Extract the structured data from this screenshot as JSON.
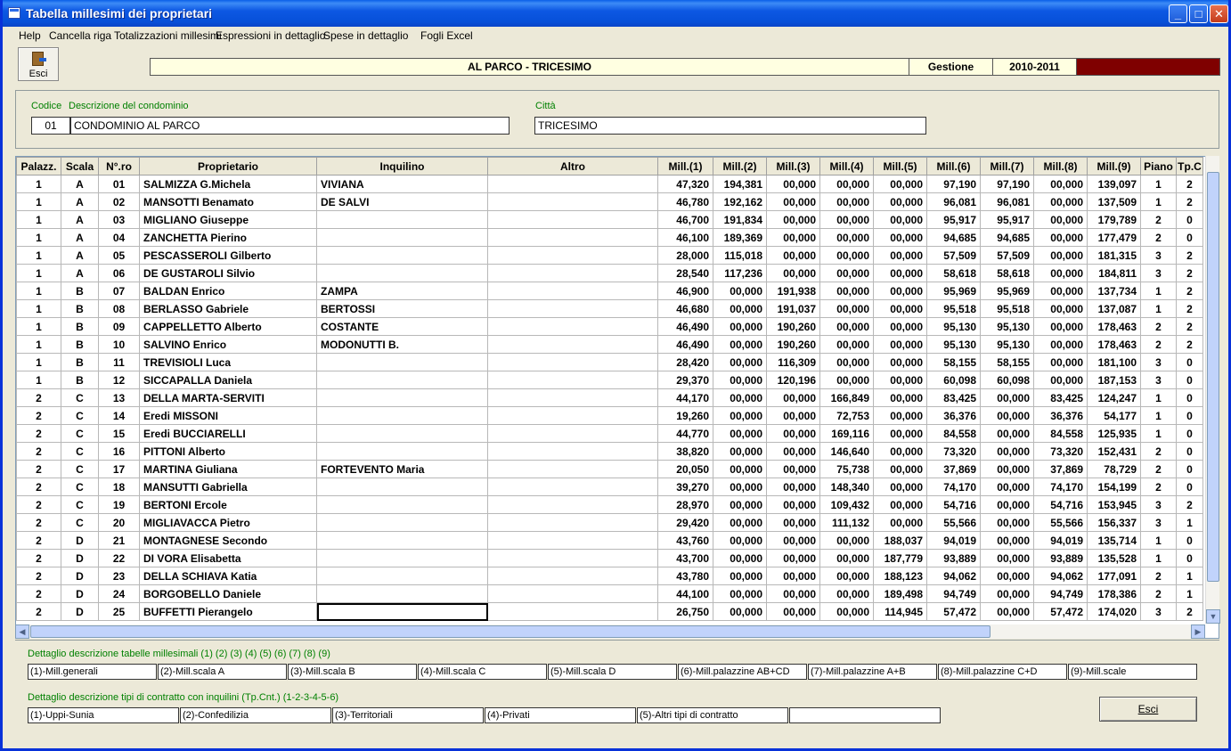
{
  "window": {
    "title": "Tabella millesimi dei proprietari"
  },
  "menu": [
    "Help",
    "Cancella riga",
    "Totalizzazioni millesimi",
    "Espressioni in dettaglio",
    "Spese in dettaglio",
    "Fogli Excel"
  ],
  "toolbar": {
    "esci_label": "Esci"
  },
  "header": {
    "condo_name": "AL PARCO - TRICESIMO",
    "gestione_label": "Gestione",
    "year": "2010-2011",
    "status_color": "#7F0000"
  },
  "condo": {
    "codice_label": "Codice",
    "descr_label": "Descrizione del condominio",
    "citta_label": "Città",
    "codice": "01",
    "descrizione": "CONDOMINIO AL PARCO",
    "citta": "TRICESIMO"
  },
  "grid": {
    "columns": [
      "Palazz.",
      "Scala",
      "N°.ro",
      "Proprietario",
      "Inquilino",
      "Altro",
      "Mill.(1)",
      "Mill.(2)",
      "Mill.(3)",
      "Mill.(4)",
      "Mill.(5)",
      "Mill.(6)",
      "Mill.(7)",
      "Mill.(8)",
      "Mill.(9)",
      "Piano",
      "Tp.C"
    ],
    "rows": [
      [
        "1",
        "A",
        "01",
        "SALMIZZA G.Michela",
        "VIVIANA",
        "",
        "47,320",
        "194,381",
        "00,000",
        "00,000",
        "00,000",
        "97,190",
        "97,190",
        "00,000",
        "139,097",
        "1",
        "2"
      ],
      [
        "1",
        "A",
        "02",
        "MANSOTTI Benamato",
        "DE SALVI",
        "",
        "46,780",
        "192,162",
        "00,000",
        "00,000",
        "00,000",
        "96,081",
        "96,081",
        "00,000",
        "137,509",
        "1",
        "2"
      ],
      [
        "1",
        "A",
        "03",
        "MIGLIANO Giuseppe",
        "",
        "",
        "46,700",
        "191,834",
        "00,000",
        "00,000",
        "00,000",
        "95,917",
        "95,917",
        "00,000",
        "179,789",
        "2",
        "0"
      ],
      [
        "1",
        "A",
        "04",
        "ZANCHETTA Pierino",
        "",
        "",
        "46,100",
        "189,369",
        "00,000",
        "00,000",
        "00,000",
        "94,685",
        "94,685",
        "00,000",
        "177,479",
        "2",
        "0"
      ],
      [
        "1",
        "A",
        "05",
        "PESCASSEROLI Gilberto",
        "",
        "",
        "28,000",
        "115,018",
        "00,000",
        "00,000",
        "00,000",
        "57,509",
        "57,509",
        "00,000",
        "181,315",
        "3",
        "2"
      ],
      [
        "1",
        "A",
        "06",
        "DE GUSTAROLI Silvio",
        "",
        "",
        "28,540",
        "117,236",
        "00,000",
        "00,000",
        "00,000",
        "58,618",
        "58,618",
        "00,000",
        "184,811",
        "3",
        "2"
      ],
      [
        "1",
        "B",
        "07",
        "BALDAN Enrico",
        "ZAMPA",
        "",
        "46,900",
        "00,000",
        "191,938",
        "00,000",
        "00,000",
        "95,969",
        "95,969",
        "00,000",
        "137,734",
        "1",
        "2"
      ],
      [
        "1",
        "B",
        "08",
        "BERLASSO Gabriele",
        "BERTOSSI",
        "",
        "46,680",
        "00,000",
        "191,037",
        "00,000",
        "00,000",
        "95,518",
        "95,518",
        "00,000",
        "137,087",
        "1",
        "2"
      ],
      [
        "1",
        "B",
        "09",
        "CAPPELLETTO Alberto",
        "COSTANTE",
        "",
        "46,490",
        "00,000",
        "190,260",
        "00,000",
        "00,000",
        "95,130",
        "95,130",
        "00,000",
        "178,463",
        "2",
        "2"
      ],
      [
        "1",
        "B",
        "10",
        "SALVINO Enrico",
        "MODONUTTI B.",
        "",
        "46,490",
        "00,000",
        "190,260",
        "00,000",
        "00,000",
        "95,130",
        "95,130",
        "00,000",
        "178,463",
        "2",
        "2"
      ],
      [
        "1",
        "B",
        "11",
        "TREVISIOLI Luca",
        "",
        "",
        "28,420",
        "00,000",
        "116,309",
        "00,000",
        "00,000",
        "58,155",
        "58,155",
        "00,000",
        "181,100",
        "3",
        "0"
      ],
      [
        "1",
        "B",
        "12",
        "SICCAPALLA Daniela",
        "",
        "",
        "29,370",
        "00,000",
        "120,196",
        "00,000",
        "00,000",
        "60,098",
        "60,098",
        "00,000",
        "187,153",
        "3",
        "0"
      ],
      [
        "2",
        "C",
        "13",
        "DELLA MARTA-SERVITI",
        "",
        "",
        "44,170",
        "00,000",
        "00,000",
        "166,849",
        "00,000",
        "83,425",
        "00,000",
        "83,425",
        "124,247",
        "1",
        "0"
      ],
      [
        "2",
        "C",
        "14",
        "Eredi MISSONI",
        "",
        "",
        "19,260",
        "00,000",
        "00,000",
        "72,753",
        "00,000",
        "36,376",
        "00,000",
        "36,376",
        "54,177",
        "1",
        "0"
      ],
      [
        "2",
        "C",
        "15",
        "Eredi BUCCIARELLI",
        "",
        "",
        "44,770",
        "00,000",
        "00,000",
        "169,116",
        "00,000",
        "84,558",
        "00,000",
        "84,558",
        "125,935",
        "1",
        "0"
      ],
      [
        "2",
        "C",
        "16",
        "PITTONI Alberto",
        "",
        "",
        "38,820",
        "00,000",
        "00,000",
        "146,640",
        "00,000",
        "73,320",
        "00,000",
        "73,320",
        "152,431",
        "2",
        "0"
      ],
      [
        "2",
        "C",
        "17",
        "MARTINA Giuliana",
        "FORTEVENTO Maria",
        "",
        "20,050",
        "00,000",
        "00,000",
        "75,738",
        "00,000",
        "37,869",
        "00,000",
        "37,869",
        "78,729",
        "2",
        "0"
      ],
      [
        "2",
        "C",
        "18",
        "MANSUTTI Gabriella",
        "",
        "",
        "39,270",
        "00,000",
        "00,000",
        "148,340",
        "00,000",
        "74,170",
        "00,000",
        "74,170",
        "154,199",
        "2",
        "0"
      ],
      [
        "2",
        "C",
        "19",
        "BERTONI Ercole",
        "",
        "",
        "28,970",
        "00,000",
        "00,000",
        "109,432",
        "00,000",
        "54,716",
        "00,000",
        "54,716",
        "153,945",
        "3",
        "2"
      ],
      [
        "2",
        "C",
        "20",
        "MIGLIAVACCA Pietro",
        "",
        "",
        "29,420",
        "00,000",
        "00,000",
        "111,132",
        "00,000",
        "55,566",
        "00,000",
        "55,566",
        "156,337",
        "3",
        "1"
      ],
      [
        "2",
        "D",
        "21",
        "MONTAGNESE Secondo",
        "",
        "",
        "43,760",
        "00,000",
        "00,000",
        "00,000",
        "188,037",
        "94,019",
        "00,000",
        "94,019",
        "135,714",
        "1",
        "0"
      ],
      [
        "2",
        "D",
        "22",
        "DI VORA Elisabetta",
        "",
        "",
        "43,700",
        "00,000",
        "00,000",
        "00,000",
        "187,779",
        "93,889",
        "00,000",
        "93,889",
        "135,528",
        "1",
        "0"
      ],
      [
        "2",
        "D",
        "23",
        "DELLA SCHIAVA Katia",
        "",
        "",
        "43,780",
        "00,000",
        "00,000",
        "00,000",
        "188,123",
        "94,062",
        "00,000",
        "94,062",
        "177,091",
        "2",
        "1"
      ],
      [
        "2",
        "D",
        "24",
        "BORGOBELLO Daniele",
        "",
        "",
        "44,100",
        "00,000",
        "00,000",
        "00,000",
        "189,498",
        "94,749",
        "00,000",
        "94,749",
        "178,386",
        "2",
        "1"
      ],
      [
        "2",
        "D",
        "25",
        "BUFFETTI Pierangelo",
        "",
        "",
        "26,750",
        "00,000",
        "00,000",
        "00,000",
        "114,945",
        "57,472",
        "00,000",
        "57,472",
        "174,020",
        "3",
        "2"
      ]
    ]
  },
  "details": {
    "mill_label": "Dettaglio descrizione tabelle millesimali (1) (2) (3) (4) (5) (6) (7) (8) (9)",
    "mill_items": [
      "(1)-Mill.generali",
      "(2)-Mill.scala A",
      "(3)-Mill.scala B",
      "(4)-Mill.scala C",
      "(5)-Mill.scala D",
      "(6)-Mill.palazzine AB+CD",
      "(7)-Mill.palazzine A+B",
      "(8)-Mill.palazzine C+D",
      "(9)-Mill.scale"
    ],
    "contract_label": "Dettaglio descrizione tipi di contratto con inquilini (Tp.Cnt.) (1-2-3-4-5-6)",
    "contract_items": [
      "(1)-Uppi-Sunia",
      "(2)-Confedilizia",
      "(3)-Territoriali",
      "(4)-Privati",
      "(5)-Altri tipi di contratto",
      ""
    ]
  },
  "footer": {
    "esci_label": "Esci"
  }
}
